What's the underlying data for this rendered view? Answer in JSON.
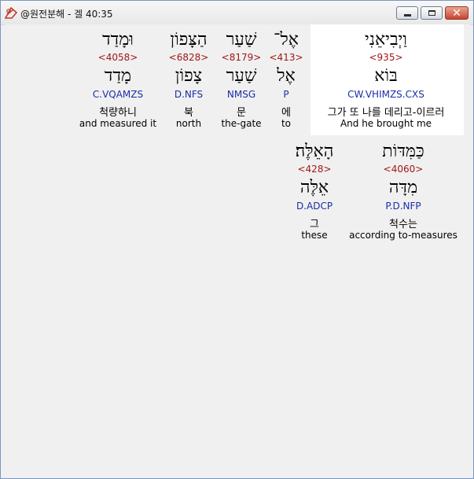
{
  "window": {
    "title": "@원전분해 - 겔 40:35"
  },
  "rows": [
    {
      "words": [
        {
          "hebrew": "וַיְבִיאֵנִי",
          "strongs": "<935>",
          "lemma": "בּוֹא",
          "parse": "CW.VHIMZS.CXS",
          "korean": "그가 또 나를 데리고-이르러",
          "gloss": "And he brought me",
          "highlighted": true
        },
        {
          "hebrew": "אֶל־",
          "strongs": "<413>",
          "lemma": "אֶל",
          "parse": "P",
          "korean": "에",
          "gloss": "to"
        },
        {
          "hebrew": "שַׁעַר",
          "strongs": "<8179>",
          "lemma": "שַׁעַר",
          "parse": "NMSG",
          "korean": "문",
          "gloss": "the-gate"
        },
        {
          "hebrew": "הַצָּפוֹן",
          "strongs": "<6828>",
          "lemma": "צָפוֹן",
          "parse": "D.NFS",
          "korean": "북",
          "gloss": "north"
        },
        {
          "hebrew": "וּמָדַד",
          "strongs": "<4058>",
          "lemma": "מָדַד",
          "parse": "C.VQAMZS",
          "korean": "척량하니",
          "gloss": "and measured it"
        }
      ]
    },
    {
      "words": [
        {
          "hebrew": "כַּמִּדּוֹת",
          "strongs": "<4060>",
          "lemma": "מִדָּה",
          "parse": "P.D.NFP",
          "korean": "척수는",
          "gloss": "according to-measures"
        },
        {
          "hebrew": "הָאֵלֶּה׃",
          "strongs": "<428>",
          "lemma": "אֵלֶּה",
          "parse": "D.ADCP",
          "korean": "그",
          "gloss": "these"
        }
      ]
    }
  ]
}
